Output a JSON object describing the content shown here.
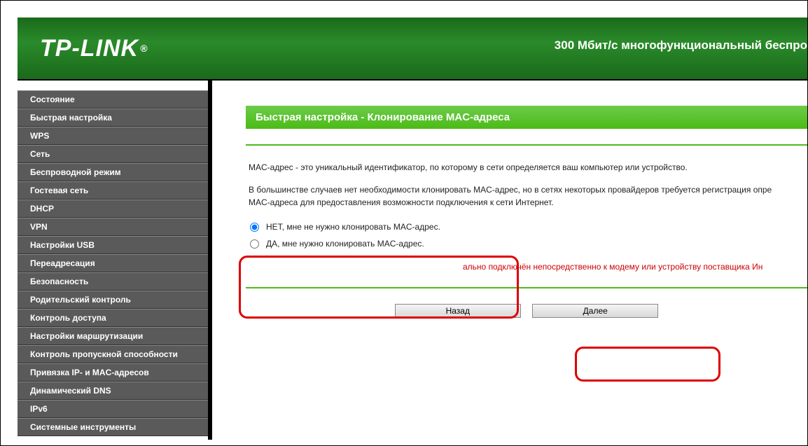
{
  "header": {
    "logo_text": "TP-LINK",
    "logo_reg": "®",
    "tagline": "300 Мбит/с многофункциональный беспро"
  },
  "sidebar": {
    "items": [
      "Состояние",
      "Быстрая настройка",
      "WPS",
      "Сеть",
      "Беспроводной режим",
      "Гостевая сеть",
      "DHCP",
      "VPN",
      "Настройки USB",
      "Переадресация",
      "Безопасность",
      "Родительский контроль",
      "Контроль доступа",
      "Настройки маршрутизации",
      "Контроль пропускной способности",
      "Привязка IP- и MAC-адресов",
      "Динамический DNS",
      "IPv6",
      "Системные инструменты"
    ]
  },
  "content": {
    "title": "Быстрая настройка - Клонирование MAC-адреса",
    "para1": "MAC-адрес - это уникальный идентификатор, по которому в сети определяется ваш компьютер или устройство.",
    "para2": "В большинстве случаев нет необходимости клонировать MAC-адрес, но в сетях некоторых провайдеров требуется регистрация опре",
    "para2b": "MAC-адреса для предоставления возможности подключения к сети Интернет.",
    "radio_no": "НЕТ, мне не нужно клонировать MAC-адрес.",
    "radio_yes": "ДА, мне нужно клонировать MAC-адрес.",
    "note": "ально подключён непосредственно к модему или устройству поставщика Ин",
    "btn_back": "Назад",
    "btn_next": "Далее"
  }
}
